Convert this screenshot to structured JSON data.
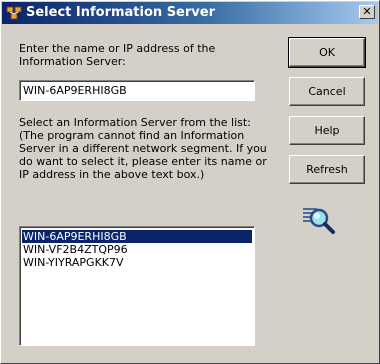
{
  "window": {
    "title": "Select Information Server",
    "close_glyph": "✕"
  },
  "prompt": {
    "line1": "Enter the name or IP address of the",
    "line2": "Information Server:"
  },
  "server_input": {
    "value": "WIN-6AP9ERHI8GB"
  },
  "instructions": {
    "lines": [
      "Select an Information Server from the list:",
      "(The program cannot find an Information",
      "Server in a different network segment. If you",
      "do want to select it, please enter its name or",
      "IP address in the above text box.)"
    ]
  },
  "server_list": {
    "items": [
      "WIN-6AP9ERHI8GB",
      "WIN-VF2B4ZTQP96",
      "WIN-YIYRAPGKK7V"
    ],
    "selected_index": 0
  },
  "buttons": {
    "ok": "OK",
    "cancel": "Cancel",
    "help": "Help",
    "refresh": "Refresh"
  },
  "icons": {
    "app": "network-computer-icon",
    "search": "magnifier-search-icon"
  },
  "colors": {
    "title_start": "#0a246a",
    "title_end": "#a6caf0",
    "selection": "#0a246a",
    "face": "#d4d0c8"
  }
}
